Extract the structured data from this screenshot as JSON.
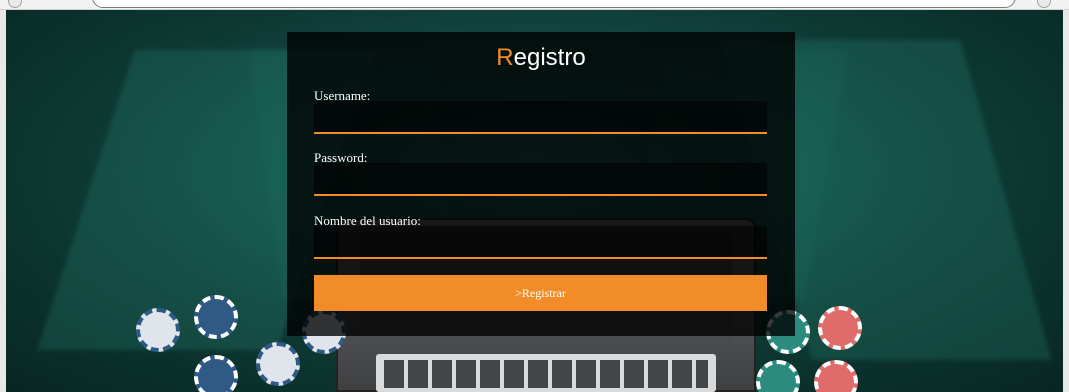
{
  "page": {
    "title_accent": "R",
    "title_rest": "egistro"
  },
  "form": {
    "username": {
      "label": "Username:",
      "value": "",
      "placeholder": ""
    },
    "password": {
      "label": "Password:",
      "value": "",
      "placeholder": ""
    },
    "nombre": {
      "label": "Nombre del usuario:",
      "value": "",
      "placeholder": ""
    },
    "submit_label": ">Registrar"
  },
  "colors": {
    "accent": "#f28c28",
    "panel_bg": "#000000",
    "text": "#ffffff"
  }
}
